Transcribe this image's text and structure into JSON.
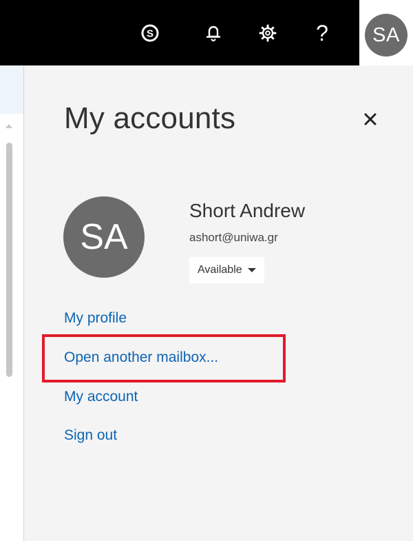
{
  "topbar": {
    "icons": [
      {
        "name": "skype-icon",
        "glyph": "S"
      },
      {
        "name": "bell-icon"
      },
      {
        "name": "gear-icon"
      },
      {
        "name": "help-icon",
        "glyph": "?"
      }
    ],
    "avatar_initials": "SA"
  },
  "panel": {
    "title": "My accounts",
    "close_glyph": "×",
    "profile": {
      "initials": "SA",
      "name": "Short Andrew",
      "email": "ashort@uniwa.gr",
      "status": "Available"
    },
    "links": [
      "My profile",
      "Open another mailbox...",
      "My account",
      "Sign out"
    ]
  },
  "colors": {
    "link": "#0c64b4",
    "annotation": "#e21b2a",
    "avatar": "#6b6b6b"
  }
}
